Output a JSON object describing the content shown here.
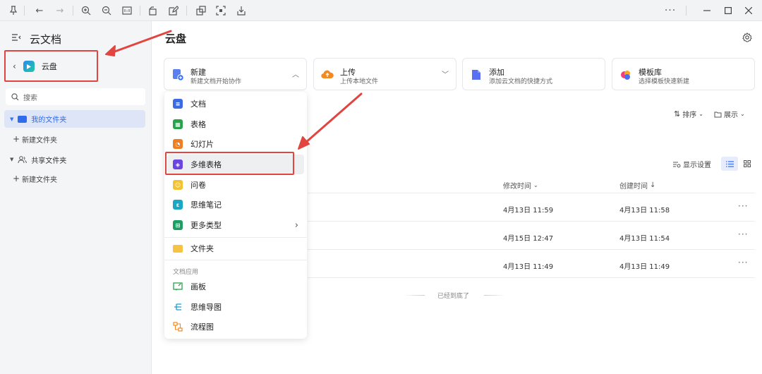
{
  "sidebar": {
    "title": "云文档",
    "back_label": "云盘",
    "search_placeholder": "搜索",
    "my_folders_label": "我的文件夹",
    "new_folder_label_1": "新建文件夹",
    "shared_folders_label": "共享文件夹",
    "new_folder_label_2": "新建文件夹"
  },
  "main": {
    "title": "云盘",
    "cards": [
      {
        "title": "新建",
        "subtitle": "新建文档开始协作"
      },
      {
        "title": "上传",
        "subtitle": "上传本地文件"
      },
      {
        "title": "添加",
        "subtitle": "添加云文档的快捷方式"
      },
      {
        "title": "模板库",
        "subtitle": "选择模板快速新建"
      }
    ],
    "sort_label": "排序",
    "view_label": "展示",
    "display_settings_label": "显示设置",
    "columns": {
      "modified": "修改时间",
      "created": "创建时间"
    },
    "rows": [
      {
        "modified": "4月13日 11:59",
        "created": "4月13日 11:58"
      },
      {
        "modified": "4月15日 12:47",
        "created": "4月13日 11:54"
      },
      {
        "modified": "4月13日 11:49",
        "created": "4月13日 11:49"
      }
    ],
    "end_label": "已经到底了"
  },
  "menu": {
    "items": [
      {
        "label": "文档",
        "icon": "doc-icon",
        "color": "#3e6ae1"
      },
      {
        "label": "表格",
        "icon": "sheet-icon",
        "color": "#27a34a"
      },
      {
        "label": "幻灯片",
        "icon": "slides-icon",
        "color": "#ef7d21"
      },
      {
        "label": "多维表格",
        "icon": "bitable-icon",
        "color": "#6b45e0"
      },
      {
        "label": "问卷",
        "icon": "form-icon",
        "color": "#f2c230"
      },
      {
        "label": "思维笔记",
        "icon": "mindnote-icon",
        "color": "#18a8c4"
      },
      {
        "label": "更多类型",
        "icon": "more-types-icon",
        "color": "#1d9e62"
      }
    ],
    "folder_label": "文件夹",
    "section_label": "文档应用",
    "apps": [
      {
        "label": "画板",
        "icon": "whiteboard-icon"
      },
      {
        "label": "思维导图",
        "icon": "mindmap-icon"
      },
      {
        "label": "流程图",
        "icon": "flowchart-icon"
      }
    ]
  },
  "colors": {
    "accent": "#3370ff",
    "annotation": "#e2453f",
    "selected_bg": "#dde5f6"
  }
}
